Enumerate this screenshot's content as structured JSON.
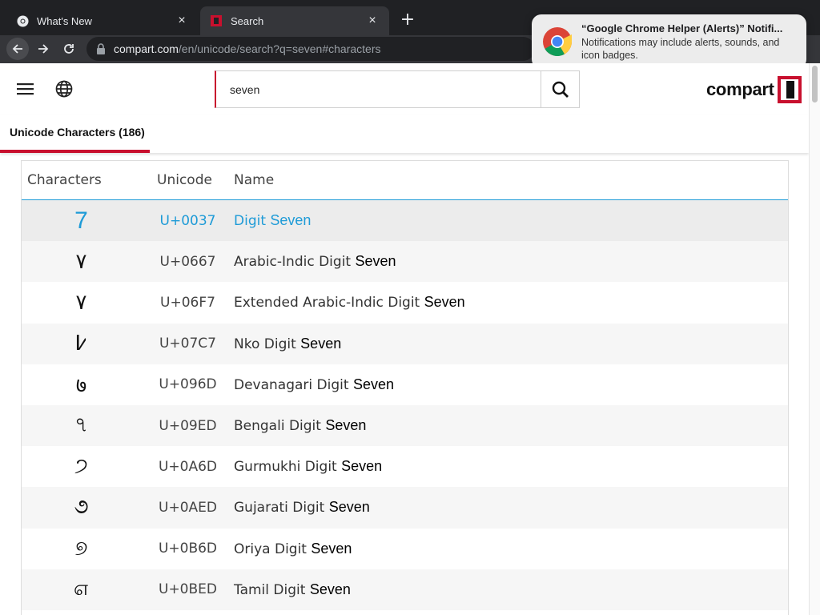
{
  "browser": {
    "tabs": [
      {
        "title": "What's New",
        "close": "×"
      },
      {
        "title": "Search",
        "close": "×"
      }
    ],
    "new_tab": "+",
    "url_host": "compart.com",
    "url_path": "/en/unicode/search?q=seven#characters"
  },
  "notification": {
    "title": "“Google Chrome Helper (Alerts)” Notifi...",
    "body": "Notifications may include alerts, sounds, and icon badges."
  },
  "site": {
    "search_value": "seven",
    "logo_text": "compart",
    "brand_color": "#c8102e",
    "accent_color": "#1e9bd7"
  },
  "section_tab": {
    "label": "Unicode Characters (186)"
  },
  "table": {
    "headers": {
      "char": "Characters",
      "code": "Unicode",
      "name": "Name"
    },
    "rows": [
      {
        "char": "7",
        "code": "U+0037",
        "name_prefix": "Digit",
        "name_match": "Seven"
      },
      {
        "char": "٧",
        "code": "U+0667",
        "name_prefix": "Arabic-Indic Digit",
        "name_match": "Seven"
      },
      {
        "char": "۷",
        "code": "U+06F7",
        "name_prefix": "Extended Arabic-Indic Digit",
        "name_match": "Seven"
      },
      {
        "char": "߇",
        "code": "U+07C7",
        "name_prefix": "Nko Digit",
        "name_match": "Seven"
      },
      {
        "char": "७",
        "code": "U+096D",
        "name_prefix": "Devanagari Digit",
        "name_match": "Seven"
      },
      {
        "char": "৭",
        "code": "U+09ED",
        "name_prefix": "Bengali Digit",
        "name_match": "Seven"
      },
      {
        "char": "੭",
        "code": "U+0A6D",
        "name_prefix": "Gurmukhi Digit",
        "name_match": "Seven"
      },
      {
        "char": "૭",
        "code": "U+0AED",
        "name_prefix": "Gujarati Digit",
        "name_match": "Seven"
      },
      {
        "char": "୭",
        "code": "U+0B6D",
        "name_prefix": "Oriya Digit",
        "name_match": "Seven"
      },
      {
        "char": "௭",
        "code": "U+0BED",
        "name_prefix": "Tamil Digit",
        "name_match": "Seven"
      }
    ]
  }
}
